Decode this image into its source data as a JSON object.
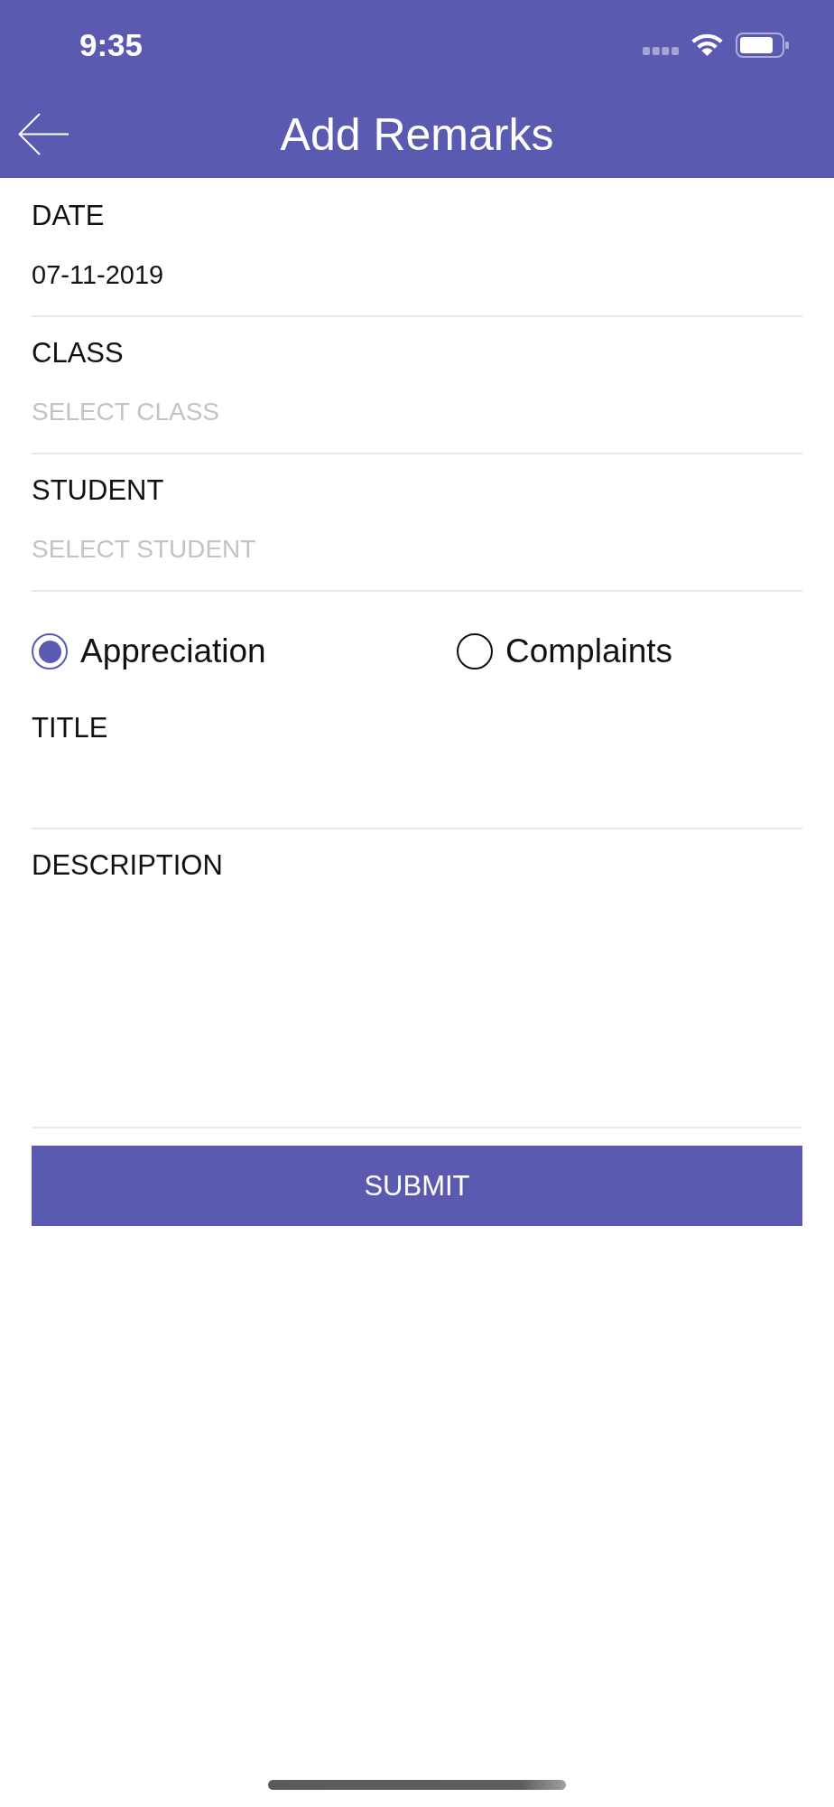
{
  "status_bar": {
    "time": "9:35"
  },
  "header": {
    "title": "Add Remarks"
  },
  "fields": [
    {
      "kind": "date",
      "label": "DATE",
      "value": "07-11-2019"
    },
    {
      "kind": "select",
      "label": "CLASS",
      "placeholder": "SELECT CLASS"
    },
    {
      "kind": "select",
      "label": "STUDENT",
      "placeholder": "SELECT STUDENT"
    }
  ],
  "remark_types": [
    {
      "label": "Appreciation",
      "selected": true
    },
    {
      "label": "Complaints",
      "selected": false
    }
  ],
  "inputs": [
    {
      "kind": "line",
      "label": "TITLE"
    },
    {
      "kind": "multiline",
      "label": "DESCRIPTION"
    }
  ],
  "submit_button": {
    "label": "SUBMIT"
  }
}
